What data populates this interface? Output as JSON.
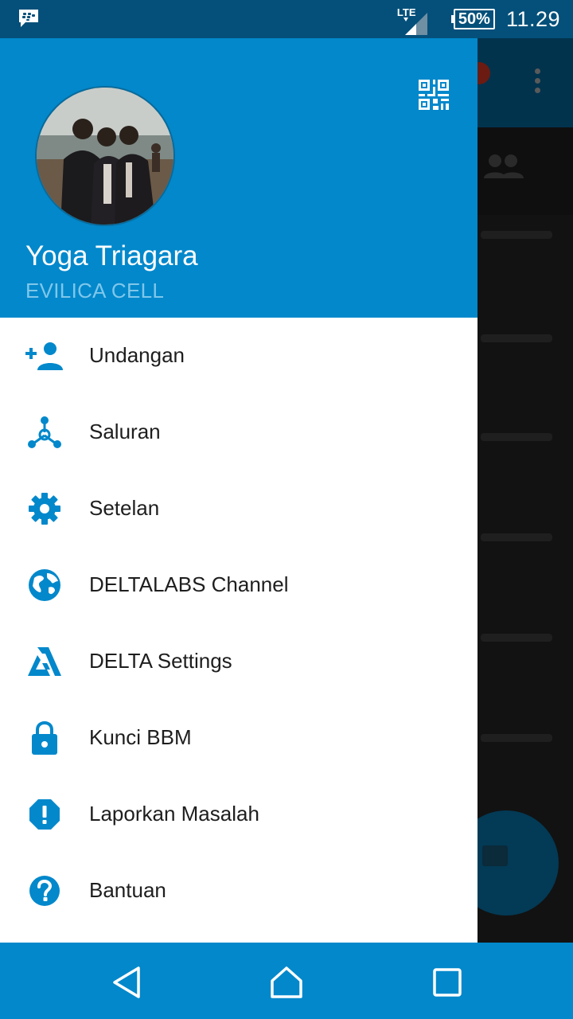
{
  "status_bar": {
    "network": "LTE",
    "battery": "50%",
    "time": "11.29"
  },
  "profile": {
    "name": "Yoga Triagara",
    "status": "EVILICA CELL"
  },
  "menu": [
    {
      "label": "Undangan",
      "icon": "add-person-icon"
    },
    {
      "label": "Saluran",
      "icon": "channels-icon"
    },
    {
      "label": "Setelan",
      "icon": "gear-icon"
    },
    {
      "label": "DELTALABS Channel",
      "icon": "globe-icon"
    },
    {
      "label": "DELTA Settings",
      "icon": "delta-logo-icon"
    },
    {
      "label": "Kunci BBM",
      "icon": "lock-icon"
    },
    {
      "label": "Laporkan Masalah",
      "icon": "report-problem-icon"
    },
    {
      "label": "Bantuan",
      "icon": "help-icon"
    }
  ],
  "colors": {
    "accent": "#0288cb",
    "status_bar": "#04507a",
    "icon": "#0288cb"
  }
}
